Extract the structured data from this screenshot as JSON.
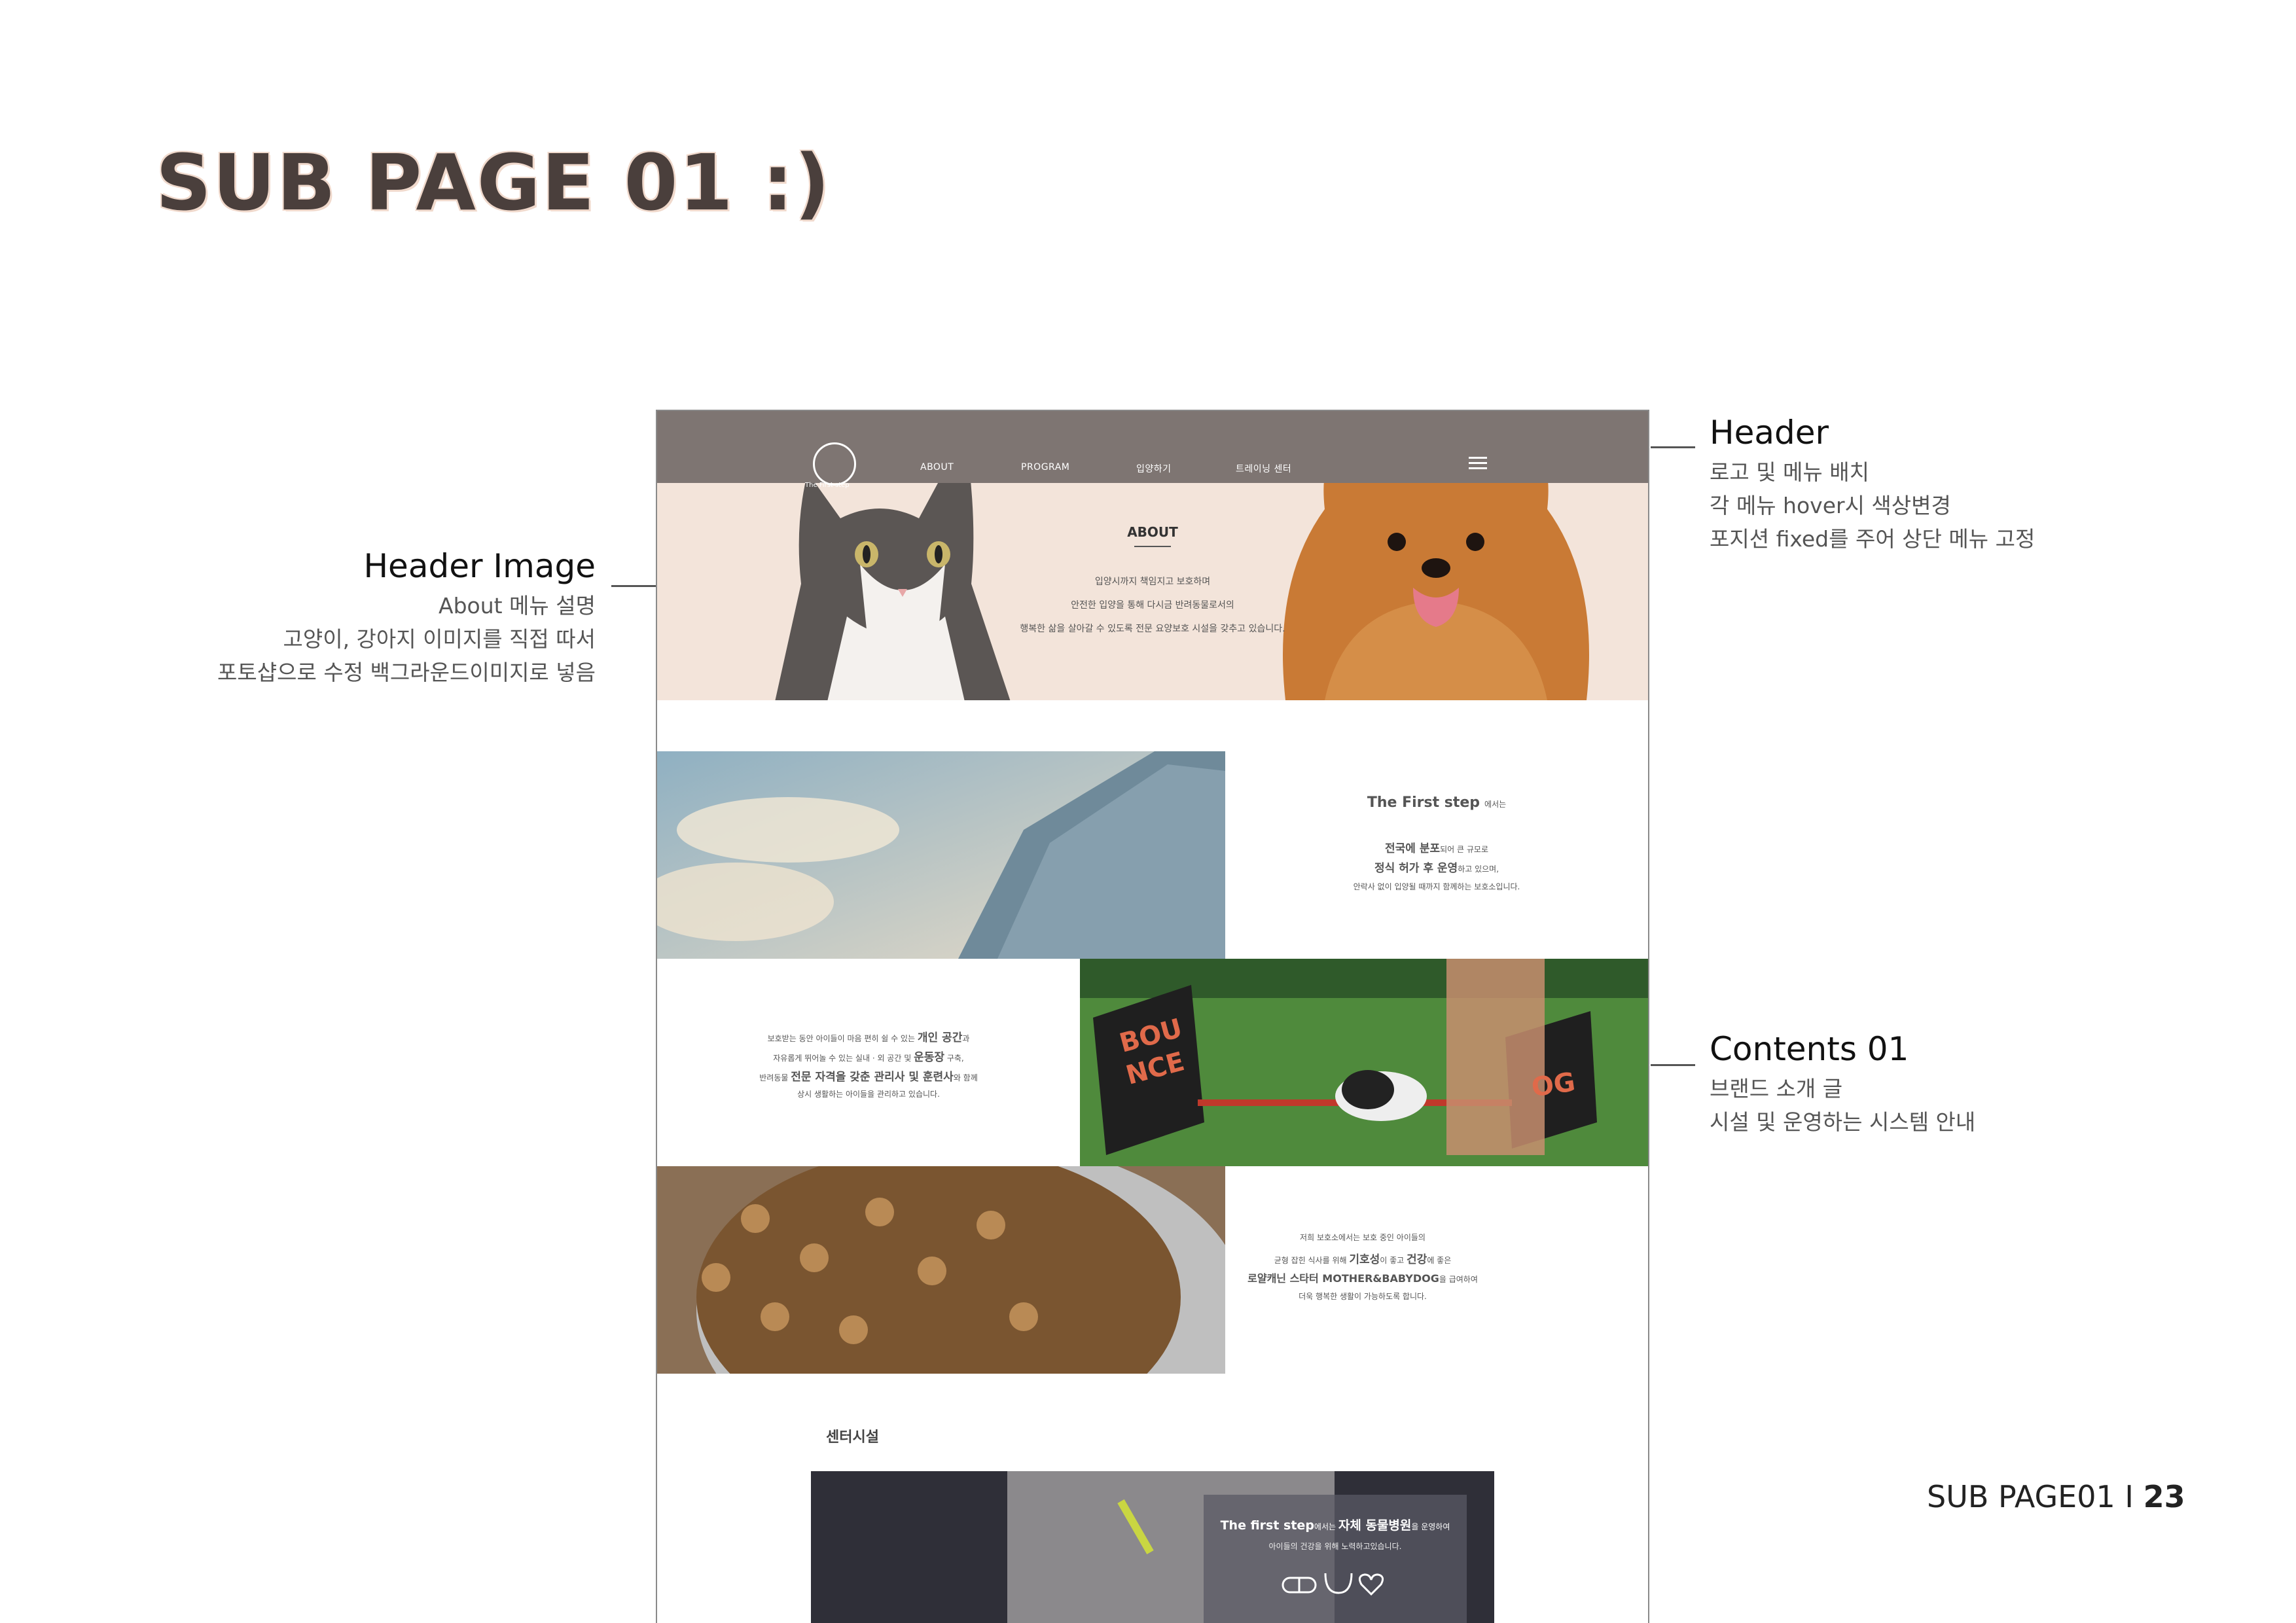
{
  "page_title": "SUB PAGE 01 :)",
  "annotations": {
    "header": {
      "title": "Header",
      "lines": [
        "로고 및 메뉴 배치",
        "각 메뉴 hover시 색상변경",
        "포지션 fixed를 주어 상단 메뉴 고정"
      ]
    },
    "header_image": {
      "title": "Header Image",
      "lines": [
        "About 메뉴 설명",
        "고양이, 강아지 이미지를 직접 따서",
        "포토샵으로 수정 백그라운드이미지로 넣음"
      ]
    },
    "contents01": {
      "title": "Contents 01",
      "lines": [
        "브랜드 소개 글",
        "시설 및 운영하는 시스템 안내"
      ]
    }
  },
  "mockup": {
    "logo_text": "The First step",
    "nav": [
      "ABOUT",
      "PROGRAM",
      "입양하기",
      "트레이닝 센터"
    ],
    "hero": {
      "heading": "ABOUT",
      "lines": [
        "입양시까지 책임지고 보호하며",
        "안전한 입양을 통해 다시금 반려동물로서의",
        "행복한 삶을 살아갈 수 있도록 전문 요양보호 시설을 갖추고 있습니다."
      ]
    },
    "block1": {
      "title_bold": "The First step",
      "title_small": "에서는",
      "line1_bold": "전국에 분포",
      "line1_rest": "되어 큰 규모로",
      "line2_bold": "정식 허가 후 운영",
      "line2_rest": "하고 있으며,",
      "line3": "안락사 없이 입양될 때까지 함께하는 보호소입니다."
    },
    "block2": {
      "l1_a": "보호받는 동안 아이들이 마음 편히 쉴 수 있는",
      "l1_b": "개인 공간",
      "l1_c": "과",
      "l2_a": "자유롭게 뛰어놀 수 있는 실내 · 외 공간 및",
      "l2_b": "운동장",
      "l2_c": "구축,",
      "l3_a": "반려동물",
      "l3_b": "전문 자격을 갖춘 관리사 및 훈련사",
      "l3_c": "와 함께",
      "l4": "상시 생활하는 아이들을 관리하고 있습니다."
    },
    "block3": {
      "l1": "저희 보호소에서는 보호 중인 아이들의",
      "l2_a": "균형 잡힌 식사를 위해",
      "l2_b": "기호성",
      "l2_c": "이 좋고",
      "l2_d": "건강",
      "l2_e": "에 좋은",
      "l3_a": "로얄캐닌 스타터 MOTHER&BABYDOG",
      "l3_b": "을 급여하여",
      "l4": "더욱 행복한 생활이 가능하도록 합니다."
    },
    "sign_letters": [
      "BOU",
      "NCE"
    ],
    "sign_right": "OG",
    "facility_title": "센터시설",
    "vet": {
      "title_a": "The first step",
      "title_b": "에서는",
      "title_c": "자체 동물병원",
      "title_d": "을 운영하여",
      "line2": "아이들의 건강을 위해 노력하고있습니다."
    }
  },
  "footer": {
    "label": "SUB PAGE01 I ",
    "page": "23"
  },
  "colors": {
    "nav_bg": "#7e7572",
    "hero_bg": "#f3e4da",
    "title": "#4a3f3c"
  }
}
